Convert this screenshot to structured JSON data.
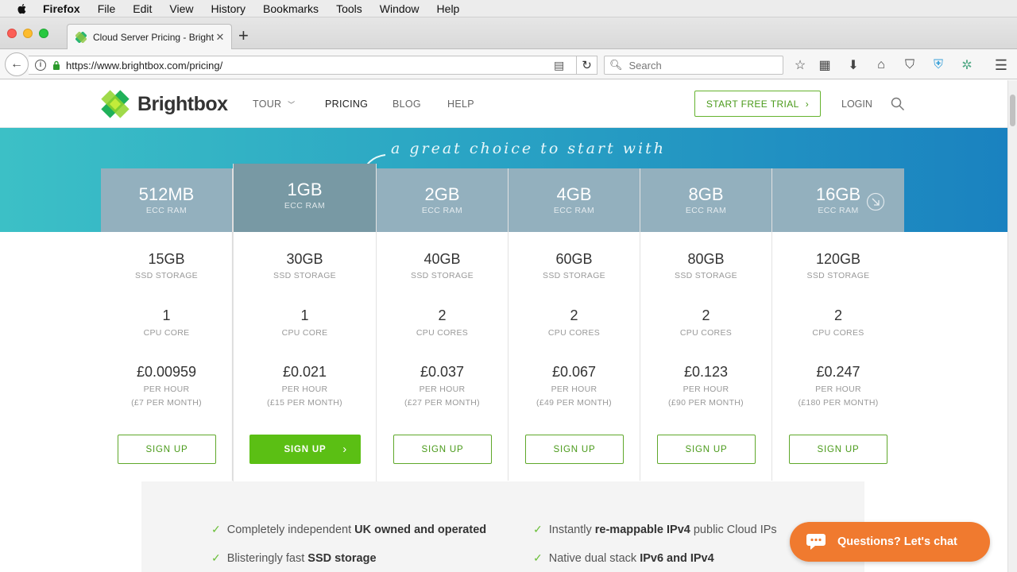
{
  "menubar": {
    "app": "Firefox",
    "items": [
      "File",
      "Edit",
      "View",
      "History",
      "Bookmarks",
      "Tools",
      "Window",
      "Help"
    ]
  },
  "tab": {
    "title": "Cloud Server Pricing - Brightbox"
  },
  "navbar": {
    "url": "https://www.brightbox.com/pricing/",
    "search_placeholder": "Search"
  },
  "site": {
    "logo": "Brightbox",
    "nav": [
      "TOUR",
      "PRICING",
      "BLOG",
      "HELP"
    ],
    "trial_label": "START FREE TRIAL",
    "login_label": "LOGIN",
    "tagline": "a great choice to start with"
  },
  "plans": [
    {
      "ram": "512MB",
      "ram_label": "ECC RAM",
      "storage": "15GB",
      "storage_label": "SSD STORAGE",
      "cpu": "1",
      "cpu_label": "CPU CORE",
      "price": "£0.00959",
      "per_hour": "PER HOUR",
      "per_month": "(£7 PER MONTH)",
      "button": "SIGN UP"
    },
    {
      "ram": "1GB",
      "ram_label": "ECC RAM",
      "storage": "30GB",
      "storage_label": "SSD STORAGE",
      "cpu": "1",
      "cpu_label": "CPU CORE",
      "price": "£0.021",
      "per_hour": "PER HOUR",
      "per_month": "(£15 PER MONTH)",
      "button": "SIGN UP"
    },
    {
      "ram": "2GB",
      "ram_label": "ECC RAM",
      "storage": "40GB",
      "storage_label": "SSD STORAGE",
      "cpu": "2",
      "cpu_label": "CPU CORES",
      "price": "£0.037",
      "per_hour": "PER HOUR",
      "per_month": "(£27 PER MONTH)",
      "button": "SIGN UP"
    },
    {
      "ram": "4GB",
      "ram_label": "ECC RAM",
      "storage": "60GB",
      "storage_label": "SSD STORAGE",
      "cpu": "2",
      "cpu_label": "CPU CORES",
      "price": "£0.067",
      "per_hour": "PER HOUR",
      "per_month": "(£49 PER MONTH)",
      "button": "SIGN UP"
    },
    {
      "ram": "8GB",
      "ram_label": "ECC RAM",
      "storage": "80GB",
      "storage_label": "SSD STORAGE",
      "cpu": "2",
      "cpu_label": "CPU CORES",
      "price": "£0.123",
      "per_hour": "PER HOUR",
      "per_month": "(£90 PER MONTH)",
      "button": "SIGN UP"
    },
    {
      "ram": "16GB",
      "ram_label": "ECC RAM",
      "storage": "120GB",
      "storage_label": "SSD STORAGE",
      "cpu": "2",
      "cpu_label": "CPU CORES",
      "price": "£0.247",
      "per_hour": "PER HOUR",
      "per_month": "(£180 PER MONTH)",
      "button": "SIGN UP"
    }
  ],
  "features": {
    "left1": {
      "pre": "Completely independent ",
      "bold": "UK owned and operated",
      "post": ""
    },
    "left2": {
      "pre": "Blisteringly fast ",
      "bold": "SSD storage",
      "post": ""
    },
    "right1": {
      "pre": "Instantly ",
      "bold": "re-mappable IPv4",
      "post": " public Cloud IPs"
    },
    "right2": {
      "pre": "Native dual stack ",
      "bold": "IPv6 and IPv4",
      "post": ""
    }
  },
  "chat": {
    "label": "Questions? Let's chat"
  },
  "colors": {
    "accent_green": "#5bbf14",
    "chat_orange": "#f07a2f",
    "hero_start": "#3cc0c6",
    "hero_end": "#1a82c0"
  }
}
